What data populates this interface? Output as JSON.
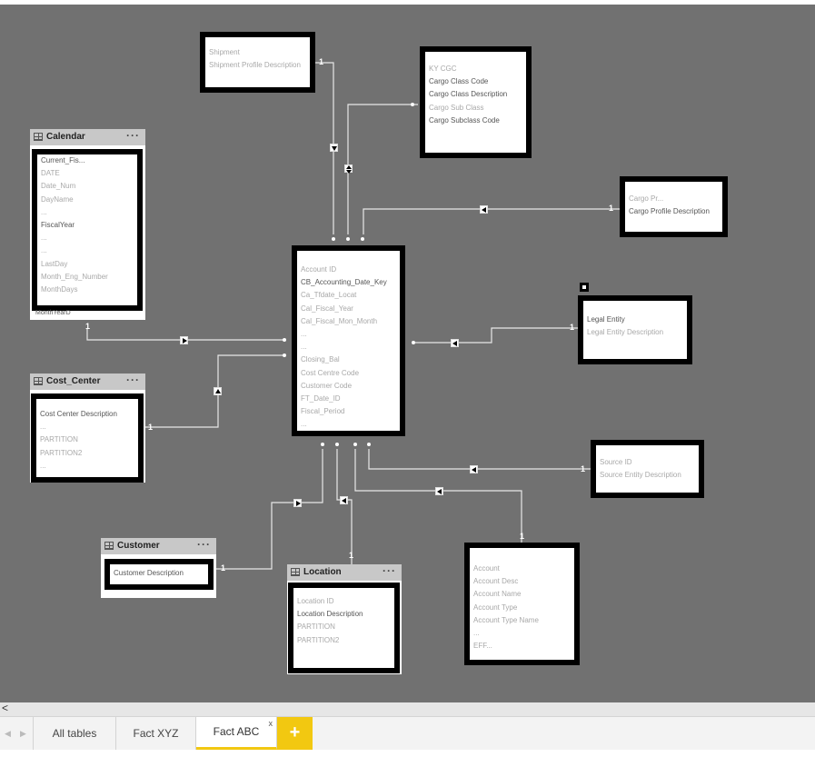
{
  "tables": {
    "calendar": {
      "title": "Calendar",
      "more": "···",
      "fields": [
        "Current_Fis...",
        "DATE",
        "Date_Num",
        "DayName",
        "...",
        "FiscalYear",
        "...",
        "...",
        "LastDay",
        "Month_Eng_Number",
        "MonthDays"
      ],
      "extra": "MonthYearD"
    },
    "cost_center": {
      "title": "Cost_Center",
      "more": "···",
      "fields": [
        "Cost Center Description",
        "...",
        "PARTITION",
        "PARTITION2",
        "..."
      ]
    },
    "customer": {
      "title": "Customer",
      "more": "···",
      "fields": [
        "Customer Description"
      ]
    },
    "location": {
      "title": "Location",
      "more": "···",
      "fields": [
        "Location ID",
        "Location Description",
        "PARTITION",
        "PARTITION2"
      ]
    },
    "shipment": {
      "fields": [
        "Shipment",
        "Shipment Profile Description"
      ]
    },
    "cargo": {
      "fields": [
        "KY CGC",
        "Cargo Class Code",
        "Cargo Class Description",
        "Cargo Sub Class",
        "Cargo Subclass Code"
      ]
    },
    "cargo_profile": {
      "fields": [
        "Cargo Pr...",
        "Cargo Profile Description"
      ]
    },
    "legal_entity": {
      "fields": [
        "Legal Entity",
        "Legal Entity Description"
      ]
    },
    "source": {
      "fields": [
        "Source ID",
        "Source Entity Description"
      ]
    },
    "account": {
      "fields": [
        "Account",
        "Account Desc",
        "Account Name",
        "Account Type",
        "Account Type Name",
        "...",
        "EFF..."
      ]
    },
    "fact": {
      "fields": [
        "Account ID",
        "CB_Accounting_Date_Key",
        "Ca_Tfdate_Locat",
        "Cal_Fiscal_Year",
        "Cal_Fiscal_Mon_Month",
        "...",
        "...",
        "Closing_Bal",
        "Cost Centre Code",
        "Customer Code",
        "FT_Date_ID",
        "Fiscal_Period",
        "..."
      ]
    }
  },
  "cardinality_one": "1",
  "tabs": {
    "all": "All tables",
    "xyz": "Fact XYZ",
    "abc": "Fact ABC",
    "close": "x",
    "add": "+"
  },
  "nav": {
    "prev": "◀",
    "next": "▶",
    "scroll_left": "<"
  }
}
